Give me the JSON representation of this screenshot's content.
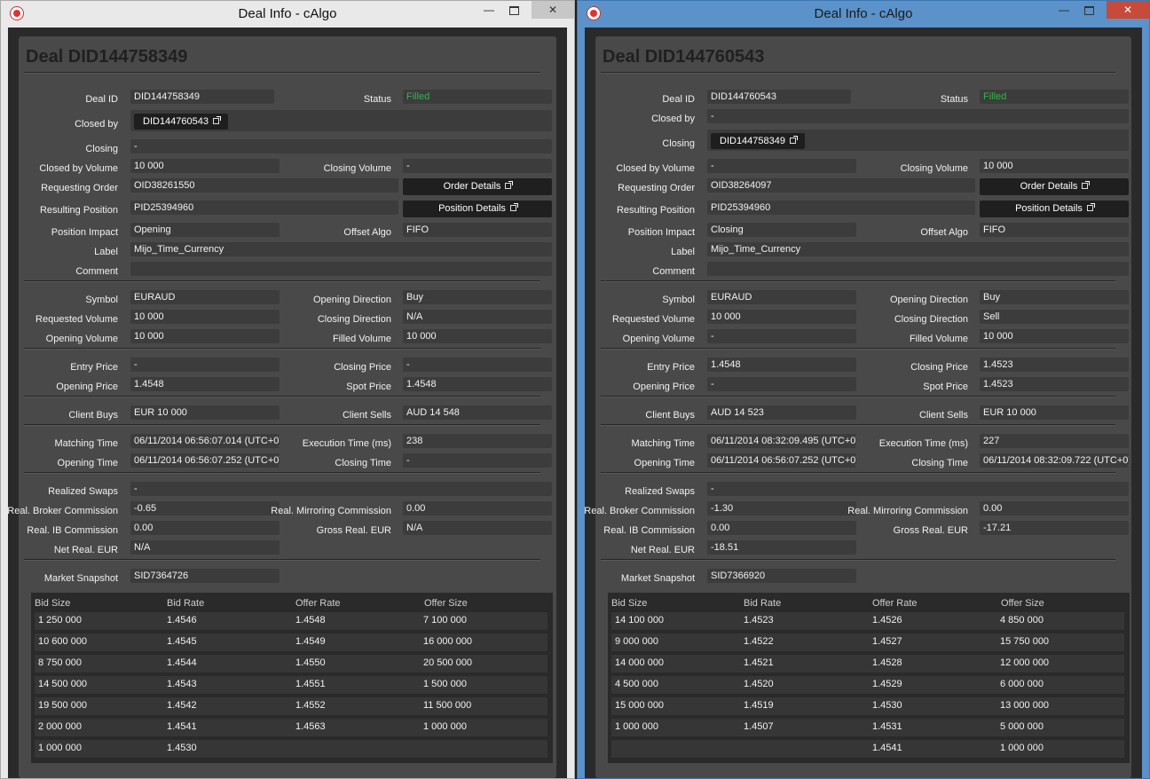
{
  "labels": {
    "deal_id": "Deal ID",
    "status": "Status",
    "closed_by": "Closed by",
    "closing": "Closing",
    "closed_by_volume": "Closed by Volume",
    "closing_volume": "Closing Volume",
    "requesting_order": "Requesting Order",
    "resulting_position": "Resulting Position",
    "position_impact": "Position Impact",
    "offset_algo": "Offset Algo",
    "label": "Label",
    "comment": "Comment",
    "symbol": "Symbol",
    "opening_direction": "Opening Direction",
    "requested_volume": "Requested Volume",
    "closing_direction": "Closing Direction",
    "opening_volume": "Opening Volume",
    "filled_volume": "Filled Volume",
    "entry_price": "Entry Price",
    "closing_price": "Closing Price",
    "opening_price": "Opening Price",
    "spot_price": "Spot Price",
    "client_buys": "Client Buys",
    "client_sells": "Client Sells",
    "matching_time": "Matching Time",
    "execution_time": "Execution Time (ms)",
    "opening_time": "Opening Time",
    "closing_time": "Closing Time",
    "realized_swaps": "Realized Swaps",
    "real_broker_commission": "Real. Broker Commission",
    "real_mirroring_commission": "Real. Mirroring Commission",
    "real_ib_commission": "Real. IB Commission",
    "gross_real_eur": "Gross Real. EUR",
    "net_real_eur": "Net Real. EUR",
    "market_snapshot": "Market Snapshot",
    "order_details_button": "Order Details",
    "position_details_button": "Position Details",
    "col_bid_size": "Bid Size",
    "col_bid_rate": "Bid Rate",
    "col_offer_rate": "Offer Rate",
    "col_offer_size": "Offer Size"
  },
  "windows": [
    {
      "title": "Deal Info - cAlgo",
      "deal_title": "Deal DID144758349",
      "deal_id": "DID144758349",
      "status": "Filled",
      "closed_by": "DID144760543",
      "closing": "-",
      "closed_by_volume": "10 000",
      "closing_volume": "-",
      "requesting_order": "OID38261550",
      "resulting_position": "PID25394960",
      "position_impact": "Opening",
      "offset_algo": "FIFO",
      "label": "Mijo_Time_Currency",
      "comment": "",
      "symbol": "EURAUD",
      "opening_direction": "Buy",
      "requested_volume": "10 000",
      "closing_direction": "N/A",
      "opening_volume": "10 000",
      "filled_volume": "10 000",
      "entry_price": "-",
      "closing_price": "-",
      "opening_price": "1.4548",
      "spot_price": "1.4548",
      "client_buys": "EUR 10 000",
      "client_sells": "AUD 14 548",
      "matching_time": "06/11/2014 06:56:07.014 (UTC+0)",
      "execution_time": "238",
      "opening_time": "06/11/2014 06:56:07.252 (UTC+0)",
      "closing_time": "-",
      "realized_swaps": "-",
      "real_broker_commission": "-0.65",
      "real_mirroring_commission": "0.00",
      "real_ib_commission": "0.00",
      "gross_real_eur": "N/A",
      "net_real_eur": "N/A",
      "market_snapshot": "SID7364726",
      "snapshot_rows": [
        {
          "bid_size": "1 250 000",
          "bid_rate": "1.4546",
          "offer_rate": "1.4548",
          "offer_size": "7 100 000"
        },
        {
          "bid_size": "10 600 000",
          "bid_rate": "1.4545",
          "offer_rate": "1.4549",
          "offer_size": "16 000 000"
        },
        {
          "bid_size": "8 750 000",
          "bid_rate": "1.4544",
          "offer_rate": "1.4550",
          "offer_size": "20 500 000"
        },
        {
          "bid_size": "14 500 000",
          "bid_rate": "1.4543",
          "offer_rate": "1.4551",
          "offer_size": "1 500 000"
        },
        {
          "bid_size": "19 500 000",
          "bid_rate": "1.4542",
          "offer_rate": "1.4552",
          "offer_size": "11 500 000"
        },
        {
          "bid_size": "2 000 000",
          "bid_rate": "1.4541",
          "offer_rate": "1.4563",
          "offer_size": "1 000 000"
        },
        {
          "bid_size": "1 000 000",
          "bid_rate": "1.4530",
          "offer_rate": "",
          "offer_size": ""
        }
      ]
    },
    {
      "title": "Deal Info - cAlgo",
      "deal_title": "Deal DID144760543",
      "deal_id": "DID144760543",
      "status": "Filled",
      "closed_by": "-",
      "closing": "DID144758349",
      "closed_by_volume": "-",
      "closing_volume": "10 000",
      "requesting_order": "OID38264097",
      "resulting_position": "PID25394960",
      "position_impact": "Closing",
      "offset_algo": "FIFO",
      "label": "Mijo_Time_Currency",
      "comment": "",
      "symbol": "EURAUD",
      "opening_direction": "Buy",
      "requested_volume": "10 000",
      "closing_direction": "Sell",
      "opening_volume": "-",
      "filled_volume": "10 000",
      "entry_price": "1.4548",
      "closing_price": "1.4523",
      "opening_price": "-",
      "spot_price": "1.4523",
      "client_buys": "AUD 14 523",
      "client_sells": "EUR 10 000",
      "matching_time": "06/11/2014 08:32:09.495 (UTC+0)",
      "execution_time": "227",
      "opening_time": "06/11/2014 06:56:07.252 (UTC+0)",
      "closing_time": "06/11/2014 08:32:09.722 (UTC+0)",
      "realized_swaps": "-",
      "real_broker_commission": "-1.30",
      "real_mirroring_commission": "0.00",
      "real_ib_commission": "0.00",
      "gross_real_eur": "-17.21",
      "net_real_eur": "-18.51",
      "market_snapshot": "SID7366920",
      "snapshot_rows": [
        {
          "bid_size": "14 100 000",
          "bid_rate": "1.4523",
          "offer_rate": "1.4526",
          "offer_size": "4 850 000"
        },
        {
          "bid_size": "9 000 000",
          "bid_rate": "1.4522",
          "offer_rate": "1.4527",
          "offer_size": "15 750 000"
        },
        {
          "bid_size": "14 000 000",
          "bid_rate": "1.4521",
          "offer_rate": "1.4528",
          "offer_size": "12 000 000"
        },
        {
          "bid_size": "4 500 000",
          "bid_rate": "1.4520",
          "offer_rate": "1.4529",
          "offer_size": "6 000 000"
        },
        {
          "bid_size": "15 000 000",
          "bid_rate": "1.4519",
          "offer_rate": "1.4530",
          "offer_size": "13 000 000"
        },
        {
          "bid_size": "1 000 000",
          "bid_rate": "1.4507",
          "offer_rate": "1.4531",
          "offer_size": "5 000 000"
        },
        {
          "bid_size": "",
          "bid_rate": "",
          "offer_rate": "1.4541",
          "offer_size": "1 000 000"
        }
      ]
    }
  ],
  "colors": {
    "status_filled": "#37b24d",
    "panel_bg": "#494949",
    "field_bg": "#3c3c3c",
    "active_frame": "#5b92c9"
  },
  "icons": {
    "app": "calgo-app-icon",
    "external_link": "external-link-icon"
  }
}
